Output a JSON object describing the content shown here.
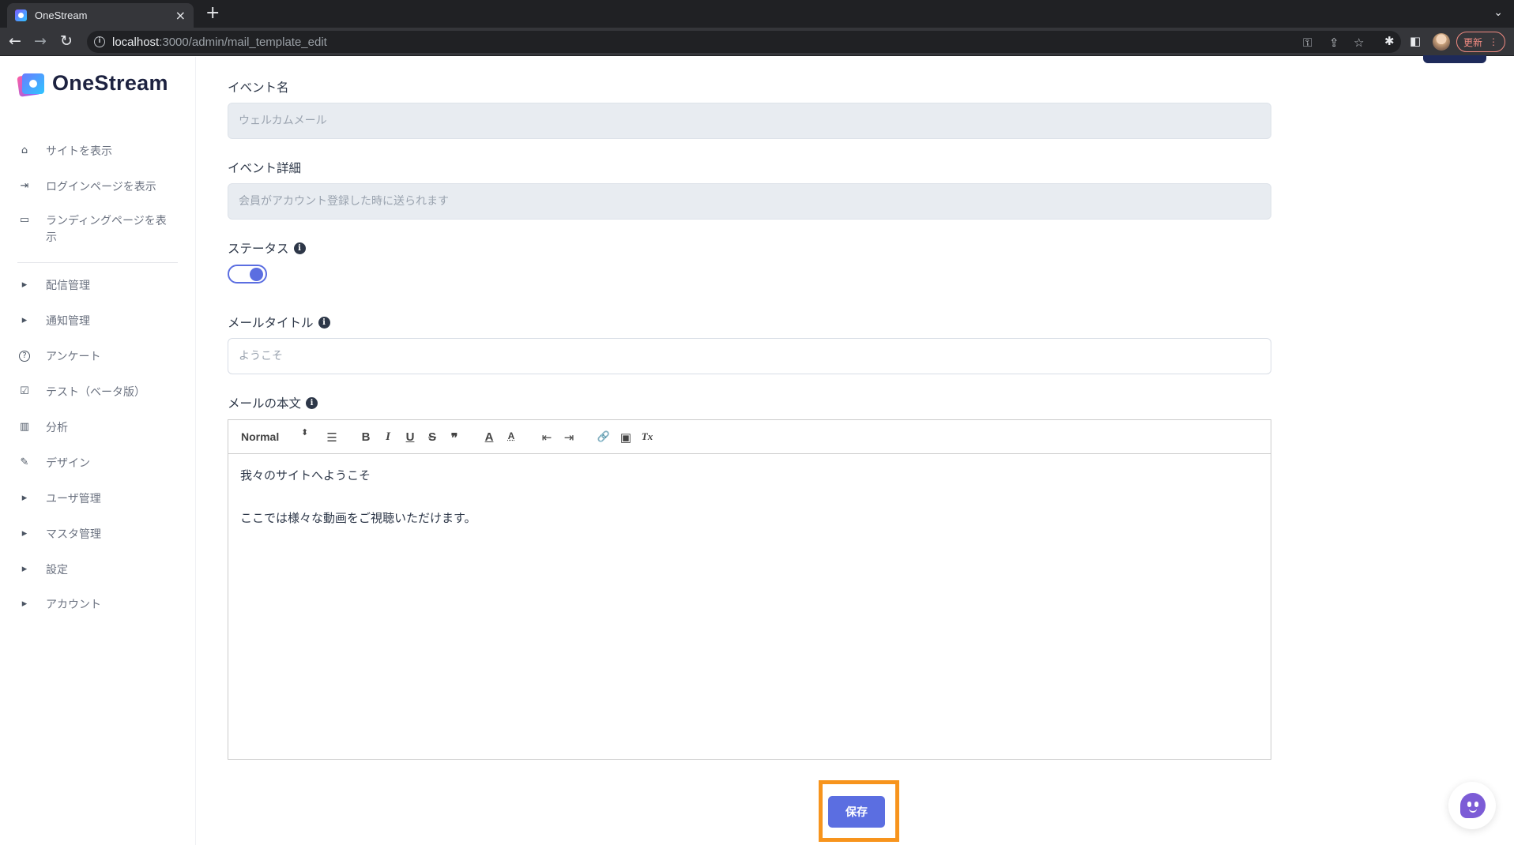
{
  "browser": {
    "tab_title": "OneStream",
    "tab_close": "×",
    "new_tab": "+",
    "tabs_menu": "⌄",
    "url_host": "localhost",
    "url_path": ":3000/admin/mail_template_edit",
    "update_label": "更新",
    "update_menu": "⋮"
  },
  "sidebar": {
    "logo_text": "OneStream",
    "items": [
      {
        "icon": "home-icon",
        "glyph": "⌂",
        "label": "サイトを表示"
      },
      {
        "icon": "sign-in-icon",
        "glyph": "⇥",
        "label": "ログインページを表示"
      },
      {
        "icon": "landing-page-icon",
        "glyph": "▭",
        "label": "ランディングページを表示"
      },
      {
        "icon": "caret-right-icon",
        "glyph": "▸",
        "label": "配信管理"
      },
      {
        "icon": "caret-right-icon",
        "glyph": "▸",
        "label": "通知管理"
      },
      {
        "icon": "question-circle-icon",
        "glyph": "?",
        "label": "アンケート"
      },
      {
        "icon": "check-square-icon",
        "glyph": "☑",
        "label": "テスト（ベータ版）"
      },
      {
        "icon": "bar-chart-icon",
        "glyph": "▥",
        "label": "分析"
      },
      {
        "icon": "edit-icon",
        "glyph": "✎",
        "label": "デザイン"
      },
      {
        "icon": "caret-right-icon",
        "glyph": "▸",
        "label": "ユーザ管理"
      },
      {
        "icon": "caret-right-icon",
        "glyph": "▸",
        "label": "マスタ管理"
      },
      {
        "icon": "caret-right-icon",
        "glyph": "▸",
        "label": "設定"
      },
      {
        "icon": "caret-right-icon",
        "glyph": "▸",
        "label": "アカウント"
      }
    ]
  },
  "form": {
    "event_name_label": "イベント名",
    "event_name_value": "ウェルカムメール",
    "event_detail_label": "イベント詳細",
    "event_detail_value": "会員がアカウント登録した時に送られます",
    "status_label": "ステータス",
    "status_enabled": true,
    "mail_title_label": "メールタイトル",
    "mail_title_placeholder": "ようこそ",
    "mail_body_label": "メールの本文",
    "info_glyph": "i",
    "editor": {
      "header_select": "Normal",
      "select_arrow": "⬍",
      "tools": [
        {
          "name": "align-icon",
          "glyph": "☰"
        },
        {
          "name": "bold-icon",
          "glyph": "B"
        },
        {
          "name": "italic-icon",
          "glyph": "I"
        },
        {
          "name": "underline-icon",
          "glyph": "U"
        },
        {
          "name": "strike-icon",
          "glyph": "S"
        },
        {
          "name": "blockquote-icon",
          "glyph": "❞"
        },
        {
          "name": "text-color-icon",
          "glyph": "A"
        },
        {
          "name": "background-color-icon",
          "glyph": "A"
        },
        {
          "name": "outdent-icon",
          "glyph": "⇤"
        },
        {
          "name": "indent-icon",
          "glyph": "⇥"
        },
        {
          "name": "link-icon",
          "glyph": "🔗"
        },
        {
          "name": "image-icon",
          "glyph": "▣"
        },
        {
          "name": "clean-format-icon",
          "glyph": "Tx"
        }
      ],
      "content_lines": [
        "我々のサイトへようこそ",
        "",
        "ここでは様々な動画をご視聴いただけます。"
      ]
    },
    "save_label": "保存"
  },
  "colors": {
    "accent": "#5b6ee1",
    "highlight": "#f7941d",
    "sidebar_text": "#6b7280"
  }
}
